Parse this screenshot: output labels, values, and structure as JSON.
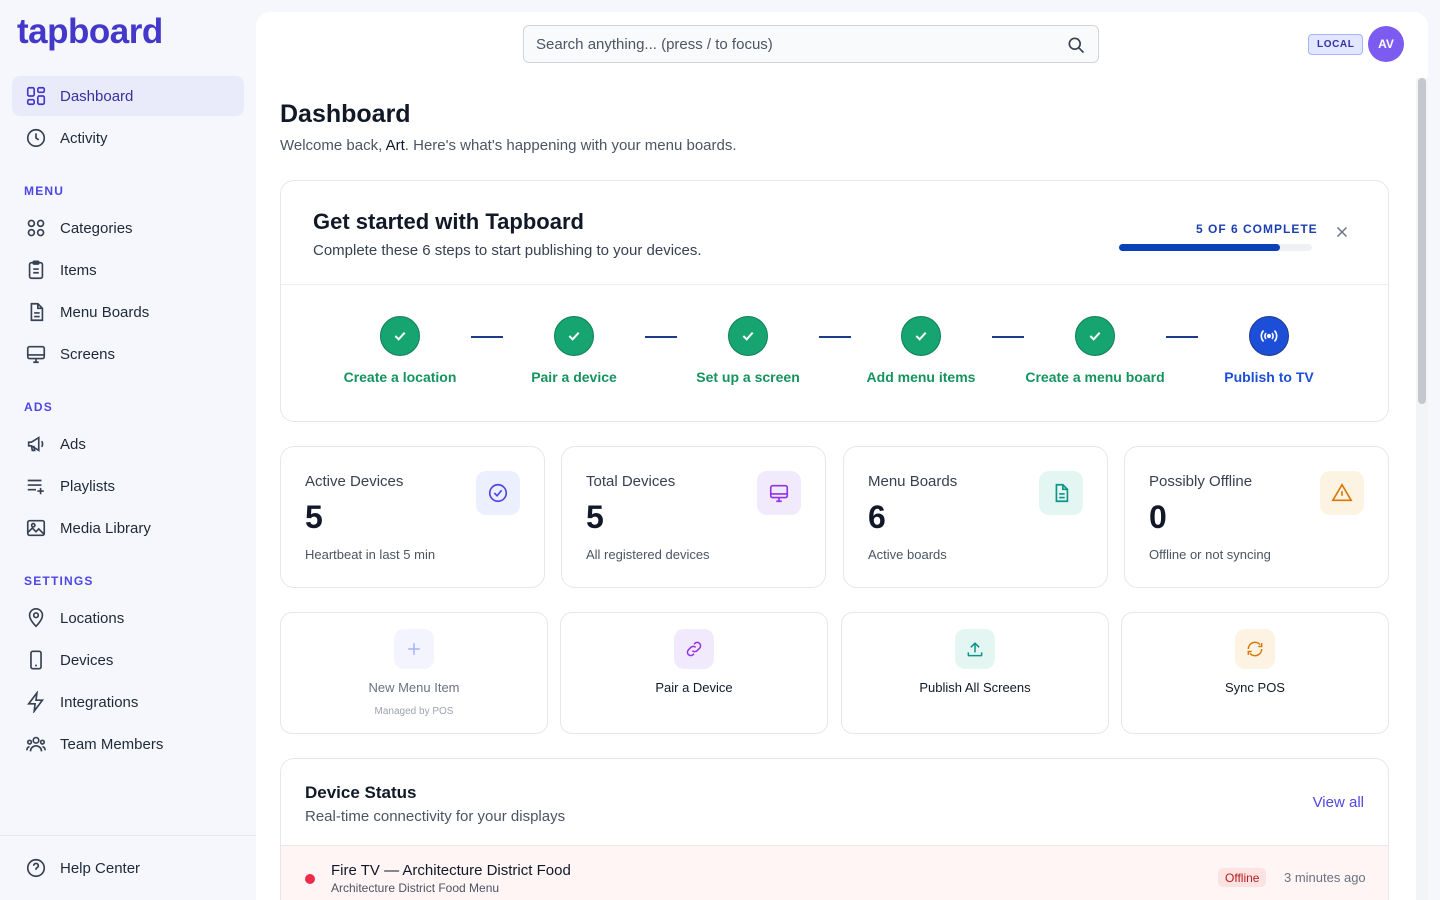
{
  "app": {
    "logo": "tapboard"
  },
  "sidebar": {
    "top_items": [
      {
        "label": "Dashboard",
        "icon": "dashboard-icon",
        "active": true
      },
      {
        "label": "Activity",
        "icon": "clock-icon"
      }
    ],
    "sections": [
      {
        "title": "MENU",
        "items": [
          {
            "label": "Categories",
            "icon": "grid-icon"
          },
          {
            "label": "Items",
            "icon": "clipboard-icon"
          },
          {
            "label": "Menu Boards",
            "icon": "document-icon"
          },
          {
            "label": "Screens",
            "icon": "monitor-icon"
          }
        ]
      },
      {
        "title": "ADS",
        "items": [
          {
            "label": "Ads",
            "icon": "megaphone-icon"
          },
          {
            "label": "Playlists",
            "icon": "playlist-icon"
          },
          {
            "label": "Media Library",
            "icon": "image-icon"
          }
        ]
      },
      {
        "title": "SETTINGS",
        "items": [
          {
            "label": "Locations",
            "icon": "map-pin-icon"
          },
          {
            "label": "Devices",
            "icon": "phone-icon"
          },
          {
            "label": "Integrations",
            "icon": "bolt-icon"
          },
          {
            "label": "Team Members",
            "icon": "users-icon"
          }
        ]
      }
    ],
    "footer": {
      "label": "Help Center",
      "icon": "help-circle-icon"
    }
  },
  "header": {
    "search_placeholder": "Search anything... (press / to focus)",
    "environment": "LOCAL",
    "avatar_initials": "AV"
  },
  "page": {
    "title": "Dashboard",
    "welcome_prefix": "Welcome back, ",
    "user_name": "Art",
    "welcome_suffix": ". Here's what's happening with your menu boards."
  },
  "onboarding": {
    "title": "Get started with Tapboard",
    "subtitle": "Complete these 6 steps to start publishing to your devices.",
    "progress_label": "5 OF 6 COMPLETE",
    "progress_fraction": 0.833,
    "steps": [
      {
        "label": "Create a location",
        "status": "complete"
      },
      {
        "label": "Pair a device",
        "status": "complete"
      },
      {
        "label": "Set up a screen",
        "status": "complete"
      },
      {
        "label": "Add menu items",
        "status": "complete"
      },
      {
        "label": "Create a menu board",
        "status": "complete"
      },
      {
        "label": "Publish to TV",
        "status": "current"
      }
    ],
    "colors": {
      "complete": "#16a571",
      "current": "#1d4ed8"
    }
  },
  "stats": [
    {
      "label": "Active Devices",
      "value": "5",
      "desc": "Heartbeat in last 5 min",
      "icon": "check-circle-icon",
      "tile_bg": "#eceffd",
      "icon_color": "#4f46e5"
    },
    {
      "label": "Total Devices",
      "value": "5",
      "desc": "All registered devices",
      "icon": "monitor-icon",
      "tile_bg": "#f1eafd",
      "icon_color": "#9333ea"
    },
    {
      "label": "Menu Boards",
      "value": "6",
      "desc": "Active boards",
      "icon": "document-icon",
      "tile_bg": "#e3f6f2",
      "icon_color": "#0d9488"
    },
    {
      "label": "Possibly Offline",
      "value": "0",
      "desc": "Offline or not syncing",
      "icon": "warning-icon",
      "tile_bg": "#fdf3e3",
      "icon_color": "#d97706"
    }
  ],
  "actions": [
    {
      "label": "New Menu Item",
      "note": "Managed by POS",
      "icon": "plus-icon",
      "disabled": true,
      "tile_bg": "#f3f4ff",
      "icon_color": "#a5b4fc"
    },
    {
      "label": "Pair a Device",
      "icon": "link-icon",
      "tile_bg": "#f1eafd",
      "icon_color": "#9333ea"
    },
    {
      "label": "Publish All Screens",
      "icon": "upload-icon",
      "tile_bg": "#e3f6f2",
      "icon_color": "#0d9488"
    },
    {
      "label": "Sync POS",
      "icon": "refresh-icon",
      "tile_bg": "#fdf3e3",
      "icon_color": "#d97706"
    }
  ],
  "device_status": {
    "title": "Device Status",
    "subtitle": "Real-time connectivity for your displays",
    "view_all": "View all",
    "rows": [
      {
        "name": "Fire TV — Architecture District Food",
        "menu": "Architecture District Food Menu",
        "status": "Offline",
        "time": "3 minutes ago",
        "status_color": "#ef2b4a"
      }
    ]
  }
}
